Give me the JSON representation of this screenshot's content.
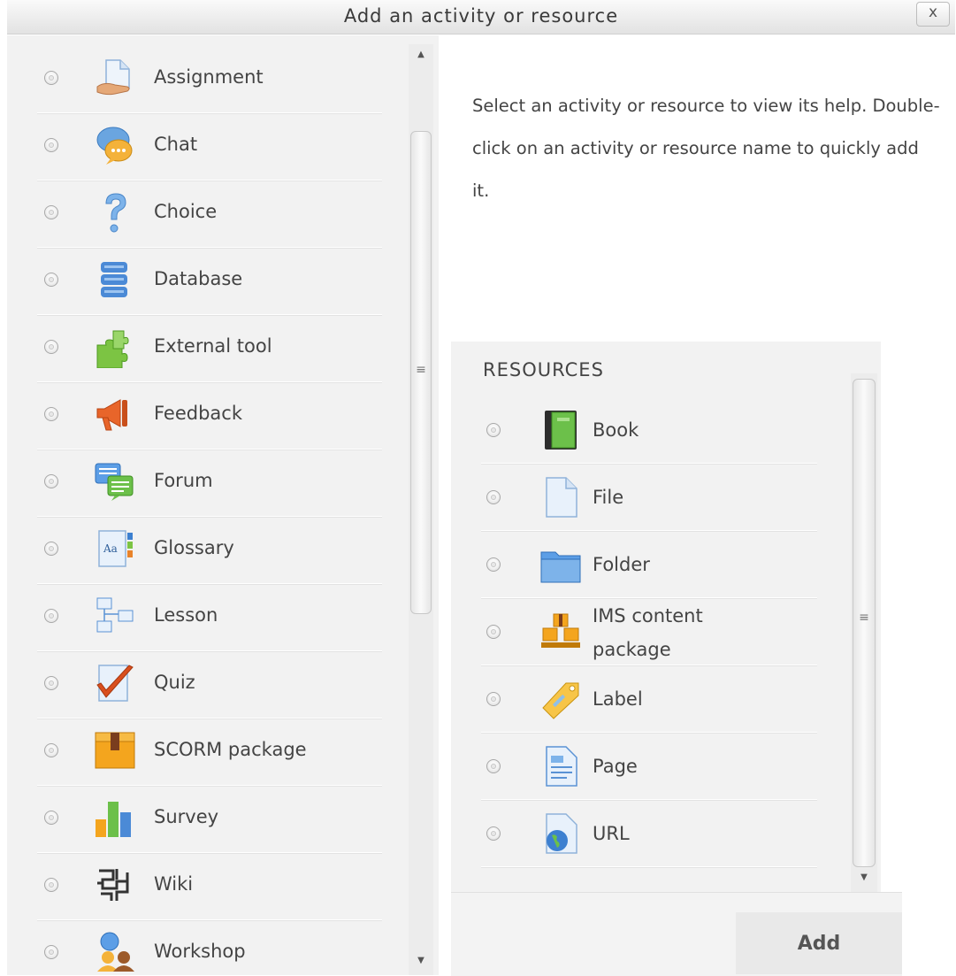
{
  "dialog": {
    "title": "Add an activity or resource",
    "close_label": "x"
  },
  "help_text": "Select an activity or resource to view its help. Double-click on an activity or resource name to quickly add it.",
  "activities": [
    {
      "label": "Assignment",
      "icon": "assignment-icon"
    },
    {
      "label": "Chat",
      "icon": "chat-icon"
    },
    {
      "label": "Choice",
      "icon": "choice-icon"
    },
    {
      "label": "Database",
      "icon": "database-icon"
    },
    {
      "label": "External tool",
      "icon": "external-tool-icon"
    },
    {
      "label": "Feedback",
      "icon": "feedback-icon"
    },
    {
      "label": "Forum",
      "icon": "forum-icon"
    },
    {
      "label": "Glossary",
      "icon": "glossary-icon"
    },
    {
      "label": "Lesson",
      "icon": "lesson-icon"
    },
    {
      "label": "Quiz",
      "icon": "quiz-icon"
    },
    {
      "label": "SCORM package",
      "icon": "scorm-icon"
    },
    {
      "label": "Survey",
      "icon": "survey-icon"
    },
    {
      "label": "Wiki",
      "icon": "wiki-icon"
    },
    {
      "label": "Workshop",
      "icon": "workshop-icon"
    }
  ],
  "resources": {
    "heading": "RESOURCES",
    "items": [
      {
        "label": "Book",
        "icon": "book-icon"
      },
      {
        "label": "File",
        "icon": "file-icon"
      },
      {
        "label": "Folder",
        "icon": "folder-icon"
      },
      {
        "label": "IMS content package",
        "line1": "IMS content",
        "line2": "package",
        "icon": "ims-package-icon"
      },
      {
        "label": "Label",
        "icon": "label-icon"
      },
      {
        "label": "Page",
        "icon": "page-icon"
      },
      {
        "label": "URL",
        "icon": "url-icon"
      }
    ]
  },
  "footer": {
    "add_label": "Add"
  }
}
